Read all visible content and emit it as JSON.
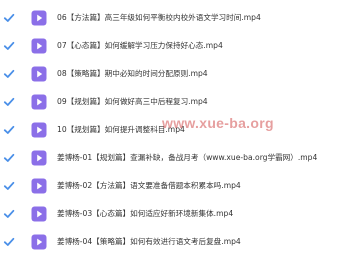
{
  "colors": {
    "checkbox": "#4a8fe8",
    "video_icon": "#8b6fe8",
    "text": "#333333",
    "watermark": "#d05050"
  },
  "icons": {
    "checkbox": "checkbox-checked-icon",
    "file": "video-file-icon"
  },
  "files": [
    {
      "name": "06【方法篇】高三年级如何平衡校内校外语文学习时间.mp4",
      "checked": true
    },
    {
      "name": "07【心态篇】如何缓解学习压力保持好心态.mp4",
      "checked": true
    },
    {
      "name": "08【策略篇】期中必知的时间分配原则.mp4",
      "checked": true
    },
    {
      "name": "09【规划篇】如何做好高三中后程复习.mp4",
      "checked": true
    },
    {
      "name": "10【规划篇】如何提升调整科目.mp4",
      "checked": true
    },
    {
      "name": "姜博杨-01【规划篇】查漏补缺，备战月考（www.xue-ba.org学霸网）.mp4",
      "checked": true
    },
    {
      "name": "姜博杨-02【方法篇】语文要准备借题本积累本吗.mp4",
      "checked": true
    },
    {
      "name": "姜博杨-03【心态篇】如何适应好新环境新集体.mp4",
      "checked": true
    },
    {
      "name": "姜博杨-04【策略篇】如何有效进行语文考后复盘.mp4",
      "checked": true
    }
  ],
  "watermark": "www.xue-ba.org"
}
